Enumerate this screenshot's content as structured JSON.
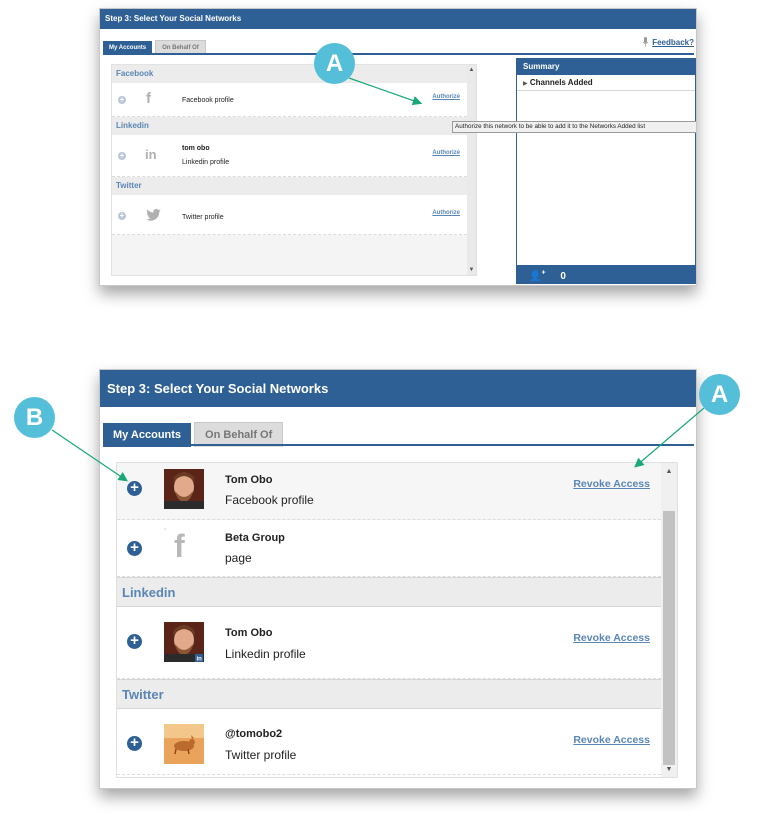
{
  "top": {
    "header_title": "Step 3: Select Your Social Networks",
    "tabs": [
      "My Accounts",
      "On Behalf Of"
    ],
    "feedback_label": "Feedback?",
    "groups": [
      {
        "name": "Facebook",
        "rows": [
          {
            "name": "",
            "sub": "Facebook profile",
            "action": "Authorize"
          }
        ]
      },
      {
        "name": "Linkedin",
        "rows": [
          {
            "name": "tom obo",
            "sub": "Linkedin profile",
            "action": "Authorize"
          }
        ]
      },
      {
        "name": "Twitter",
        "rows": [
          {
            "name": "",
            "sub": "Twitter profile",
            "action": "Authorize"
          }
        ]
      }
    ],
    "tooltip": "Authorize this network to be able to add it to the Networks Added list",
    "summary": {
      "title": "Summary",
      "item": "Channels Added",
      "count": "0"
    }
  },
  "bottom": {
    "header_title": "Step 3: Select Your Social Networks",
    "tabs": [
      "My Accounts",
      "On Behalf Of"
    ],
    "rows": [
      {
        "name": "Tom Obo",
        "sub": "Facebook profile",
        "action": "Revoke Access"
      },
      {
        "name": "Beta Group",
        "sub": "page",
        "action": ""
      },
      {
        "name": "Tom Obo",
        "sub": "Linkedin profile",
        "action": "Revoke Access"
      },
      {
        "name": "@tomobo2",
        "sub": "Twitter profile",
        "action": "Revoke Access"
      }
    ],
    "group_linkedin": "Linkedin",
    "group_twitter": "Twitter"
  },
  "callouts": {
    "a": "A",
    "b": "B"
  },
  "colors": {
    "brand_blue": "#2f6095",
    "callout_cyan": "#55bfd9",
    "link_blue": "#5a86b5"
  },
  "icons": [
    "plus-circle-icon",
    "facebook-icon",
    "linkedin-icon",
    "twitter-icon",
    "microphone-icon",
    "add-user-icon"
  ]
}
